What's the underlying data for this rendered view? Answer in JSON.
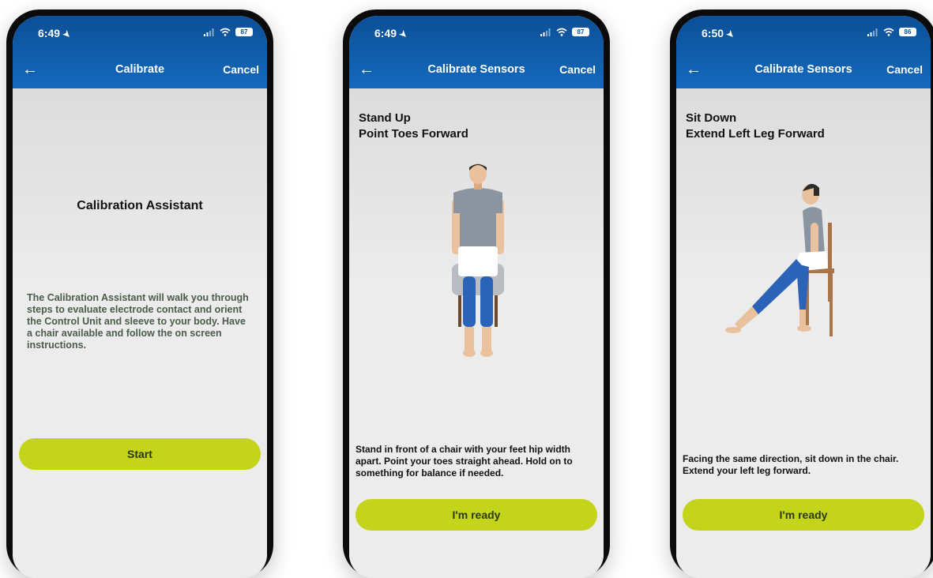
{
  "colors": {
    "header_blue": "#0b4f97",
    "button_lime": "#c3d41a",
    "screen_bg": "#e9e9e9",
    "shirt_gray": "#8b95a1",
    "pants_blue": "#2a63b8",
    "chair_brown": "#a8744a"
  },
  "screens": [
    {
      "time": "6:49",
      "battery": "87",
      "back_icon": "back-arrow-icon",
      "title": "Calibrate",
      "cancel": "Cancel",
      "assistant_title": "Calibration Assistant",
      "description": "The Calibration Assistant will walk you through steps to evaluate electrode contact and orient the Control Unit and sleeve to your body. Have a chair available and follow the on screen instructions.",
      "button": "Start"
    },
    {
      "time": "6:49",
      "battery": "87",
      "back_icon": "back-arrow-icon",
      "title": "Calibrate Sensors",
      "cancel": "Cancel",
      "heading_line1": "Stand Up",
      "heading_line2": "Point Toes Forward",
      "illustration": "standing-person-illustration",
      "instruction": "Stand in front of a chair with your feet hip width apart. Point your toes straight ahead. Hold on to something for balance if needed.",
      "button": "I'm ready"
    },
    {
      "time": "6:50",
      "battery": "86",
      "back_icon": "back-arrow-icon",
      "title": "Calibrate Sensors",
      "cancel": "Cancel",
      "heading_line1": "Sit Down",
      "heading_line2": "Extend Left Leg Forward",
      "illustration": "seated-person-illustration",
      "instruction": "Facing the same direction, sit down in the chair. Extend your left leg forward.",
      "button": "I'm ready"
    }
  ]
}
